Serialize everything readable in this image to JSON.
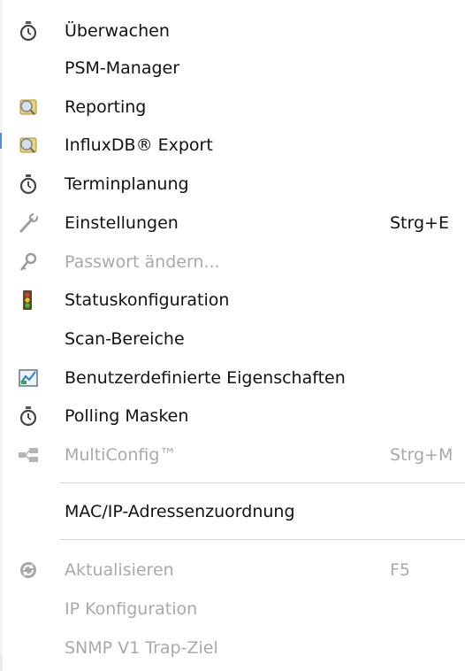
{
  "menu": {
    "items": [
      {
        "label": "Überwachen",
        "shortcut": "",
        "icon": "stopwatch-icon",
        "enabled": true
      },
      {
        "label": "PSM-Manager",
        "shortcut": "",
        "icon": "",
        "enabled": true
      },
      {
        "label": "Reporting",
        "shortcut": "",
        "icon": "report-icon",
        "enabled": true
      },
      {
        "label": "InfluxDB® Export",
        "shortcut": "",
        "icon": "report-icon",
        "enabled": true
      },
      {
        "label": "Terminplanung",
        "shortcut": "",
        "icon": "stopwatch-icon",
        "enabled": true
      },
      {
        "label": "Einstellungen",
        "shortcut": "Strg+E",
        "icon": "wrench-icon",
        "enabled": true
      },
      {
        "label": "Passwort ändern...",
        "shortcut": "",
        "icon": "key-icon",
        "enabled": false
      },
      {
        "label": "Statuskonfiguration",
        "shortcut": "",
        "icon": "traffic-light-icon",
        "enabled": true
      },
      {
        "label": "Scan-Bereiche",
        "shortcut": "",
        "icon": "",
        "enabled": true
      },
      {
        "label": "Benutzerdefinierte Eigenschaften",
        "shortcut": "",
        "icon": "custom-properties-icon",
        "enabled": true
      },
      {
        "label": "Polling Masken",
        "shortcut": "",
        "icon": "stopwatch-icon",
        "enabled": true
      },
      {
        "label": "MultiConfig™",
        "shortcut": "Strg+M",
        "icon": "multiconfig-icon",
        "enabled": false
      },
      {
        "label": "MAC/IP-Adressenzuordnung",
        "shortcut": "",
        "icon": "",
        "enabled": true
      },
      {
        "label": "Aktualisieren",
        "shortcut": "F5",
        "icon": "refresh-icon",
        "enabled": false
      },
      {
        "label": "IP Konfiguration",
        "shortcut": "",
        "icon": "",
        "enabled": false
      },
      {
        "label": "SNMP V1 Trap-Ziel",
        "shortcut": "",
        "icon": "",
        "enabled": false
      }
    ]
  },
  "colors": {
    "text": "#111111",
    "disabled_text": "#a9a9a9",
    "separator": "#d7d7d7"
  }
}
